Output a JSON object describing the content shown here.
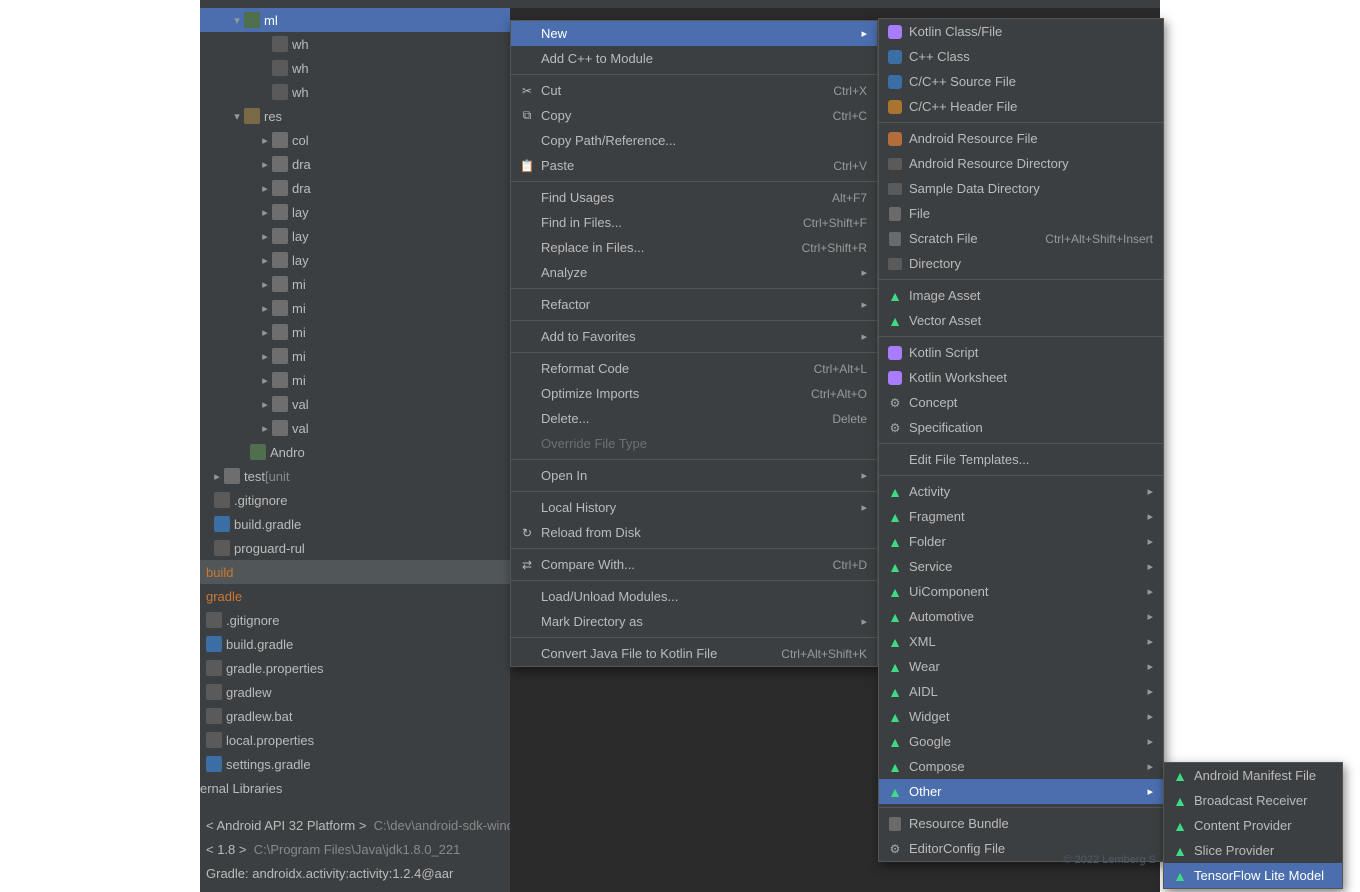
{
  "tree": {
    "ml": "ml",
    "wh1": "wh",
    "wh2": "wh",
    "wh3": "wh",
    "res": "res",
    "folders": [
      "col",
      "dra",
      "dra",
      "lay",
      "lay",
      "lay",
      "mi",
      "mi",
      "mi",
      "mi",
      "mi",
      "val",
      "val"
    ],
    "android": "Andro",
    "test": "test ",
    "unit": "[unit",
    "gitignore": ".gitignore",
    "buildgradle": "build.gradle",
    "proguard": "proguard-rul",
    "build": "build",
    "gradle": "gradle",
    "gitignore2": ".gitignore",
    "buildgradle2": "build.gradle",
    "gradleprops": "gradle.properties",
    "gradlew": "gradlew",
    "gradlewbat": "gradlew.bat",
    "localprops": "local.properties",
    "settingsgradle": "settings.gradle",
    "extlib": "ernal Libraries",
    "api": "< Android API 32 Platform >",
    "apipath": "C:\\dev\\android-sdk-windows",
    "jdk": "< 1.8 >",
    "jdkpath": "C:\\Program Files\\Java\\jdk1.8.0_221",
    "lastline": "Gradle: androidx.activity:activity:1.2.4@aar"
  },
  "ctx": [
    {
      "label": "New",
      "sel": true,
      "arrow": true
    },
    {
      "label": "Add C++ to Module"
    },
    {
      "sep": true
    },
    {
      "icon": "✂",
      "label": "Cut",
      "key": "Ctrl+X"
    },
    {
      "icon": "⧉",
      "label": "Copy",
      "key": "Ctrl+C"
    },
    {
      "label": "Copy Path/Reference..."
    },
    {
      "icon": "📋",
      "label": "Paste",
      "key": "Ctrl+V"
    },
    {
      "sep": true
    },
    {
      "label": "Find Usages",
      "key": "Alt+F7"
    },
    {
      "label": "Find in Files...",
      "key": "Ctrl+Shift+F"
    },
    {
      "label": "Replace in Files...",
      "key": "Ctrl+Shift+R"
    },
    {
      "label": "Analyze",
      "arrow": true
    },
    {
      "sep": true
    },
    {
      "label": "Refactor",
      "arrow": true
    },
    {
      "sep": true
    },
    {
      "label": "Add to Favorites",
      "arrow": true
    },
    {
      "sep": true
    },
    {
      "label": "Reformat Code",
      "key": "Ctrl+Alt+L"
    },
    {
      "label": "Optimize Imports",
      "key": "Ctrl+Alt+O"
    },
    {
      "label": "Delete...",
      "key": "Delete"
    },
    {
      "label": "Override File Type",
      "disabled": true
    },
    {
      "sep": true
    },
    {
      "label": "Open In",
      "arrow": true
    },
    {
      "sep": true
    },
    {
      "label": "Local History",
      "arrow": true
    },
    {
      "icon": "↻",
      "label": "Reload from Disk"
    },
    {
      "sep": true
    },
    {
      "icon": "⇄",
      "label": "Compare With...",
      "key": "Ctrl+D"
    },
    {
      "sep": true
    },
    {
      "label": "Load/Unload Modules..."
    },
    {
      "label": "Mark Directory as",
      "arrow": true
    },
    {
      "sep": true
    },
    {
      "label": "Convert Java File to Kotlin File",
      "key": "Ctrl+Alt+Shift+K"
    }
  ],
  "newmenu": [
    {
      "ic": "kt",
      "label": "Kotlin Class/File"
    },
    {
      "ic": "c",
      "label": "C++ Class"
    },
    {
      "ic": "c",
      "label": "C/C++ Source File"
    },
    {
      "ic": "h",
      "label": "C/C++ Header File"
    },
    {
      "sep": true
    },
    {
      "ic": "xml",
      "label": "Android Resource File"
    },
    {
      "ic": "dir",
      "label": "Android Resource Directory"
    },
    {
      "ic": "dir",
      "label": "Sample Data Directory"
    },
    {
      "ic": "file",
      "label": "File"
    },
    {
      "ic": "file",
      "label": "Scratch File",
      "key": "Ctrl+Alt+Shift+Insert"
    },
    {
      "ic": "dir",
      "label": "Directory"
    },
    {
      "sep": true
    },
    {
      "ic": "and",
      "label": "Image Asset"
    },
    {
      "ic": "and",
      "label": "Vector Asset"
    },
    {
      "sep": true
    },
    {
      "ic": "kt",
      "label": "Kotlin Script"
    },
    {
      "ic": "kt",
      "label": "Kotlin Worksheet"
    },
    {
      "ic": "gear",
      "label": "Concept"
    },
    {
      "ic": "gear",
      "label": "Specification"
    },
    {
      "sep": true
    },
    {
      "label": "Edit File Templates..."
    },
    {
      "sep": true
    },
    {
      "ic": "and",
      "label": "Activity",
      "arrow": true
    },
    {
      "ic": "and",
      "label": "Fragment",
      "arrow": true
    },
    {
      "ic": "and",
      "label": "Folder",
      "arrow": true
    },
    {
      "ic": "and",
      "label": "Service",
      "arrow": true
    },
    {
      "ic": "and",
      "label": "UiComponent",
      "arrow": true
    },
    {
      "ic": "and",
      "label": "Automotive",
      "arrow": true
    },
    {
      "ic": "and",
      "label": "XML",
      "arrow": true
    },
    {
      "ic": "and",
      "label": "Wear",
      "arrow": true
    },
    {
      "ic": "and",
      "label": "AIDL",
      "arrow": true
    },
    {
      "ic": "and",
      "label": "Widget",
      "arrow": true
    },
    {
      "ic": "and",
      "label": "Google",
      "arrow": true
    },
    {
      "ic": "and",
      "label": "Compose",
      "arrow": true
    },
    {
      "ic": "and",
      "label": "Other",
      "arrow": true,
      "sel": true
    },
    {
      "sep": true
    },
    {
      "ic": "file",
      "label": "Resource Bundle"
    },
    {
      "ic": "gear",
      "label": "EditorConfig File"
    }
  ],
  "othermenu": [
    {
      "label": "Android Manifest File"
    },
    {
      "label": "Broadcast Receiver"
    },
    {
      "label": "Content Provider"
    },
    {
      "label": "Slice Provider"
    },
    {
      "label": "TensorFlow Lite Model",
      "sel": true
    }
  ],
  "watermark": "© 2022  Lemberg S"
}
